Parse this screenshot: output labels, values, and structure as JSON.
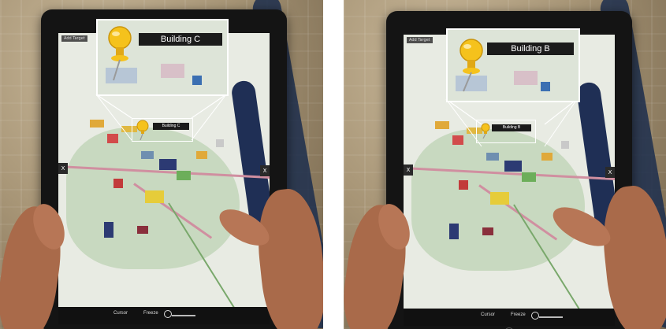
{
  "panels": [
    {
      "id": "left",
      "building_label": "Building C",
      "mini_label": "Building C",
      "tab_label": "Add Target",
      "close_icon": "X",
      "bottom_bar": {
        "cursor": "Cursor",
        "freeze": "Freeze"
      }
    },
    {
      "id": "right",
      "building_label": "Building B",
      "mini_label": "Building B",
      "tab_label": "Add Target",
      "close_icon": "X",
      "bottom_bar": {
        "cursor": "Cursor",
        "freeze": "Freeze"
      }
    }
  ],
  "colors": {
    "pin_yellow": "#f5c21c",
    "label_bg": "#1b1b1b",
    "frame": "#ffffff",
    "river": "#1f2f55"
  },
  "icons": [
    "pushpin-icon",
    "close-icon",
    "search-icon",
    "slider-icon"
  ]
}
